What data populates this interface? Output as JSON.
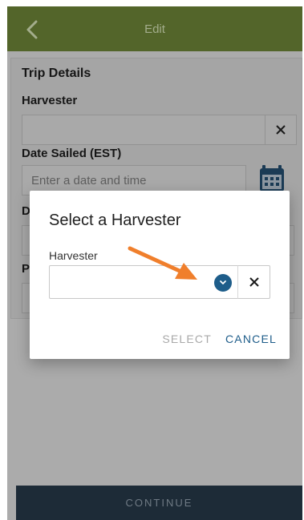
{
  "header": {
    "title": "Edit",
    "back_icon": "chevron-left-icon"
  },
  "form": {
    "section_title": "Trip Details",
    "harvester_label": "Harvester",
    "harvester_value": "",
    "date_sailed_label": "Date Sailed (EST)",
    "date_sailed_placeholder": "Enter a date and time",
    "partial_label_1": "D",
    "partial_label_2": "P"
  },
  "dialog": {
    "title": "Select a Harvester",
    "field_label": "Harvester",
    "selected_value": "",
    "clear_symbol": "×",
    "select_label": "SELECT",
    "cancel_label": "CANCEL"
  },
  "footer": {
    "continue_label": "CONTINUE"
  },
  "colors": {
    "header_bg": "#53652a",
    "accent": "#1e5d8a",
    "annotation_arrow": "#f07f2c",
    "footer_bg": "#1d2b37"
  }
}
